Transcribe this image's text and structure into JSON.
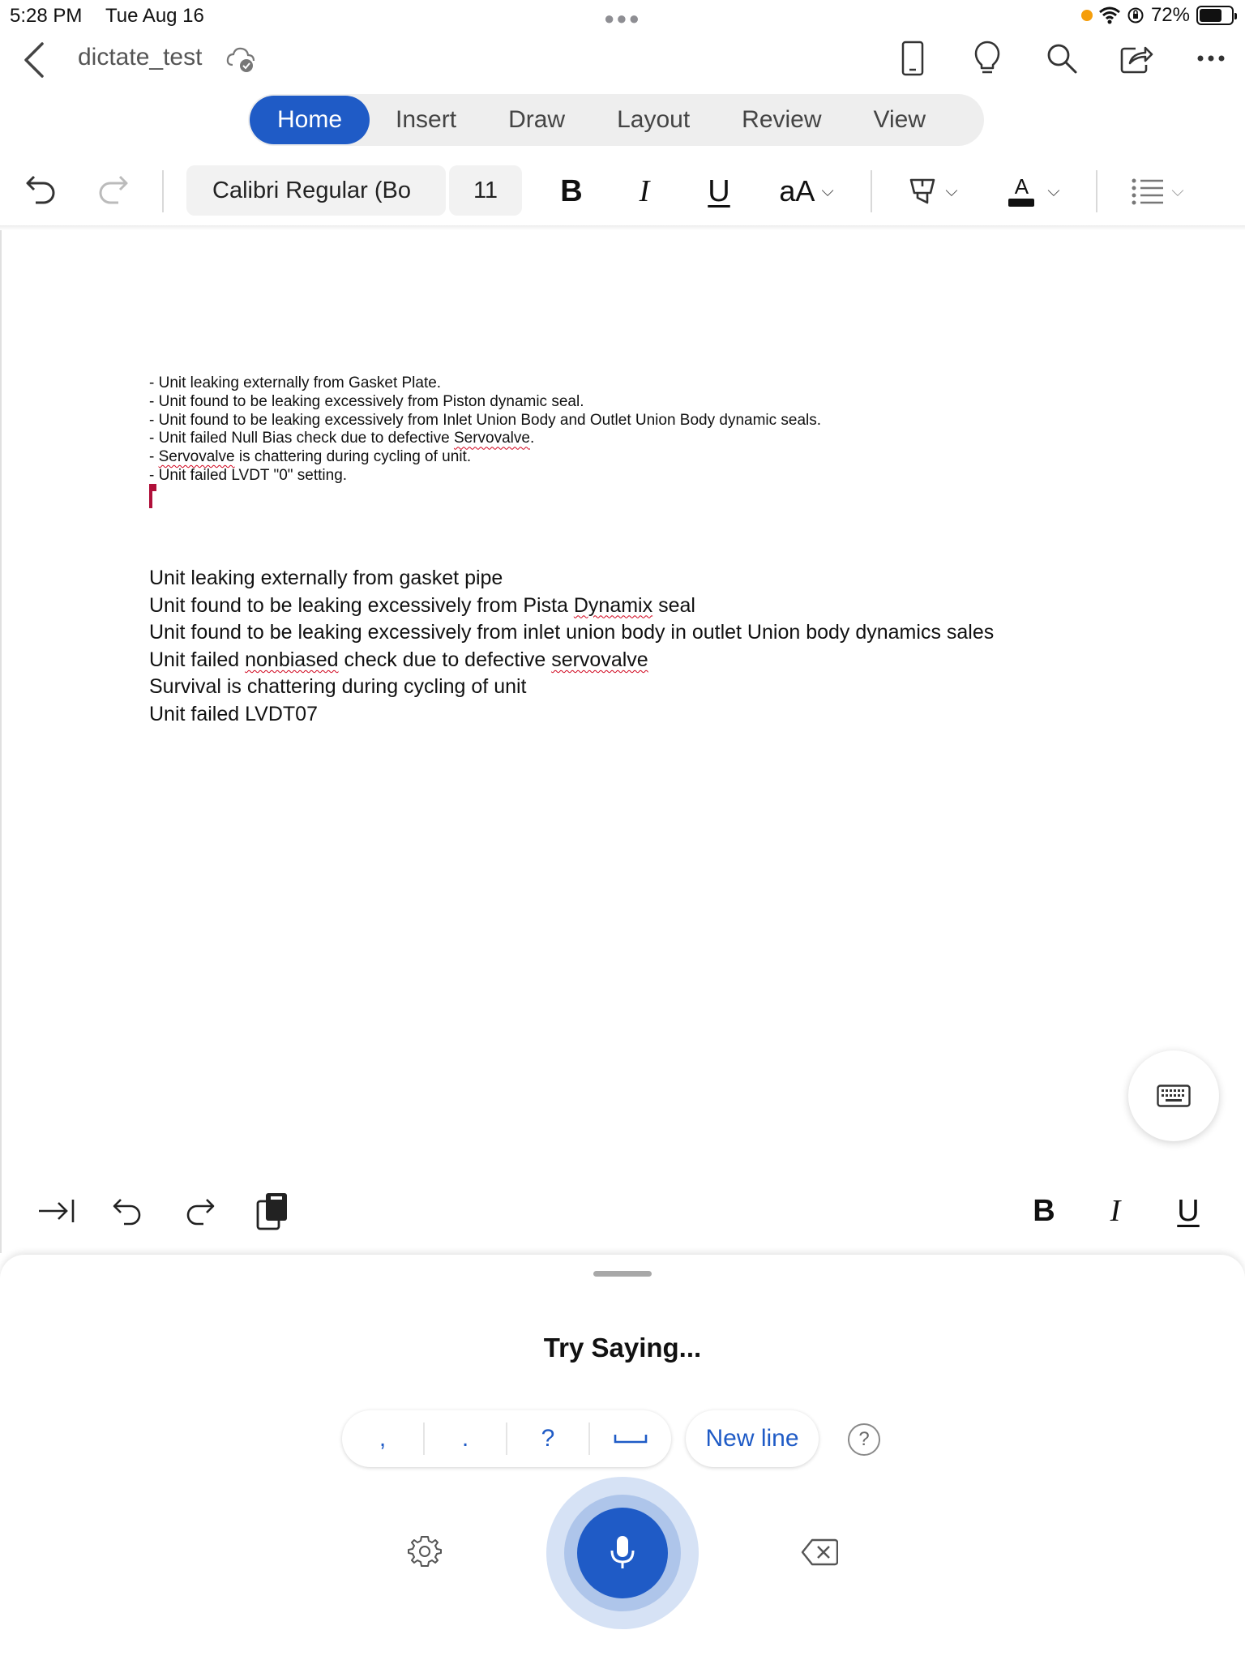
{
  "status_bar": {
    "time": "5:28 PM",
    "date": "Tue Aug 16",
    "battery": "72%",
    "battery_level": 0.72
  },
  "title_bar": {
    "doc_title": "dictate_test"
  },
  "tabs": [
    {
      "label": "Home",
      "active": true
    },
    {
      "label": "Insert",
      "active": false
    },
    {
      "label": "Draw",
      "active": false
    },
    {
      "label": "Layout",
      "active": false
    },
    {
      "label": "Review",
      "active": false
    },
    {
      "label": "View",
      "active": false
    }
  ],
  "format_bar": {
    "font_name": "Calibri Regular (Bo",
    "font_size": "11",
    "bold": "B",
    "italic": "I",
    "underline": "U",
    "font_case": "aA",
    "font_color_letter": "A"
  },
  "document": {
    "small_lines": [
      "- Unit leaking externally from Gasket Plate.",
      "- Unit found to be leaking excessively from Piston dynamic seal.",
      "- Unit found to be leaking excessively from Inlet Union Body and Outlet Union Body dynamic seals.",
      "- Unit failed Null Bias check due to defective ",
      "Servovalve",
      ".",
      "- ",
      "Servovalve",
      " is chattering during cycling of unit.",
      "- Unit failed LVDT \"0\" setting."
    ],
    "large_lines": [
      "Unit leaking externally from gasket pipe",
      "Unit found to be leaking excessively from Pista ",
      "Dynamix",
      " seal",
      "Unit found to be leaking excessively from inlet union body in outlet Union body dynamics sales",
      "Unit failed ",
      "nonbiased",
      " check due to defective ",
      "servovalve",
      "Survival is chattering during cycling of unit",
      "Unit failed LVDT07"
    ]
  },
  "accessory_bar": {
    "bold": "B",
    "italic": "I",
    "underline": "U"
  },
  "dictation": {
    "prompt": "Try Saying...",
    "punctuation": [
      ",",
      ".",
      "?",
      "␣"
    ],
    "new_line": "New line",
    "help": "?"
  },
  "colors": {
    "accent": "#1f5bc6",
    "spell_error": "#d0021b",
    "cursor": "#b0103a"
  }
}
